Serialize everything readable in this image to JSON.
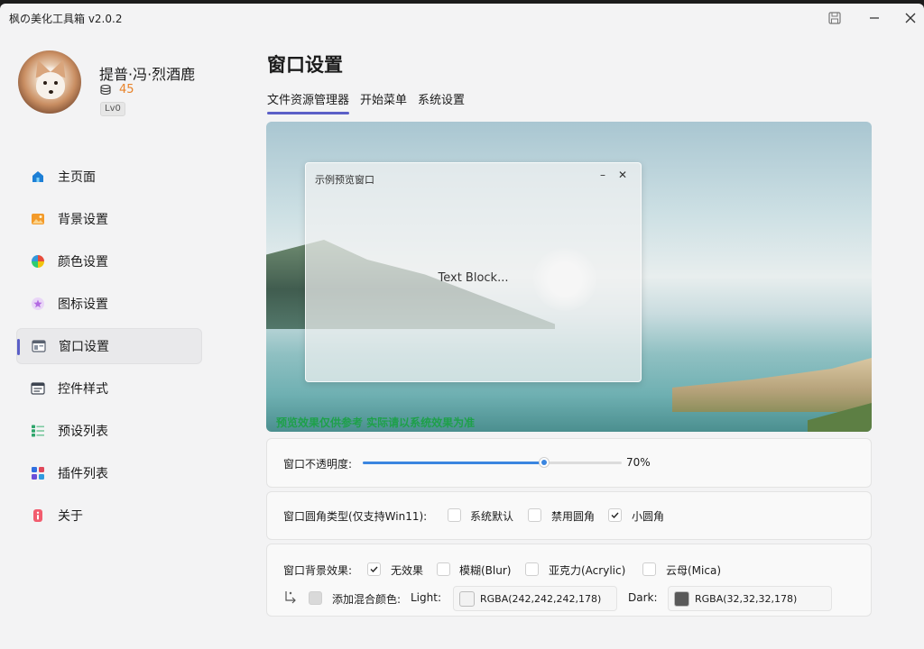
{
  "window": {
    "title": "枫の美化工具箱 v2.0.2"
  },
  "user": {
    "name": "提普·冯·烈酒鹿",
    "coins": "45",
    "level": "Lv0"
  },
  "nav": [
    {
      "label": "主页面",
      "icon": "home-icon"
    },
    {
      "label": "背景设置",
      "icon": "image-icon"
    },
    {
      "label": "颜色设置",
      "icon": "color-wheel-icon"
    },
    {
      "label": "图标设置",
      "icon": "star-icon"
    },
    {
      "label": "窗口设置",
      "icon": "window-icon",
      "active": true
    },
    {
      "label": "控件样式",
      "icon": "control-icon"
    },
    {
      "label": "预设列表",
      "icon": "list-icon"
    },
    {
      "label": "插件列表",
      "icon": "plugin-icon"
    },
    {
      "label": "关于",
      "icon": "info-icon"
    }
  ],
  "page": {
    "title": "窗口设置",
    "tabs": [
      "文件资源管理器",
      "开始菜单",
      "系统设置"
    ],
    "active_tab": 0
  },
  "preview": {
    "sample_window_title": "示例预览窗口",
    "sample_text": "Text Block...",
    "note": "预览效果仅供参考 实际请以系统效果为准"
  },
  "opacity": {
    "label": "窗口不透明度:",
    "value_text": "70%",
    "value": 0.7
  },
  "corner": {
    "label": "窗口圆角类型(仅支持Win11):",
    "options": [
      {
        "label": "系统默认",
        "checked": false
      },
      {
        "label": "禁用圆角",
        "checked": false
      },
      {
        "label": "小圆角",
        "checked": true
      }
    ]
  },
  "backdrop": {
    "label": "窗口背景效果:",
    "options": [
      {
        "label": "无效果",
        "checked": true
      },
      {
        "label": "模糊(Blur)",
        "checked": false
      },
      {
        "label": "亚克力(Acrylic)",
        "checked": false
      },
      {
        "label": "云母(Mica)",
        "checked": false
      }
    ],
    "blend_label": "添加混合颜色:",
    "light_label": "Light:",
    "light_value": "RGBA(242,242,242,178)",
    "light_color": "#f2f2f2",
    "dark_label": "Dark:",
    "dark_value": "RGBA(32,32,32,178)",
    "dark_color": "#595959"
  },
  "colors": {
    "accent": "#5b5fc7",
    "slider": "#3b86e0",
    "coin": "#e8832a",
    "note": "#1ea04a"
  }
}
